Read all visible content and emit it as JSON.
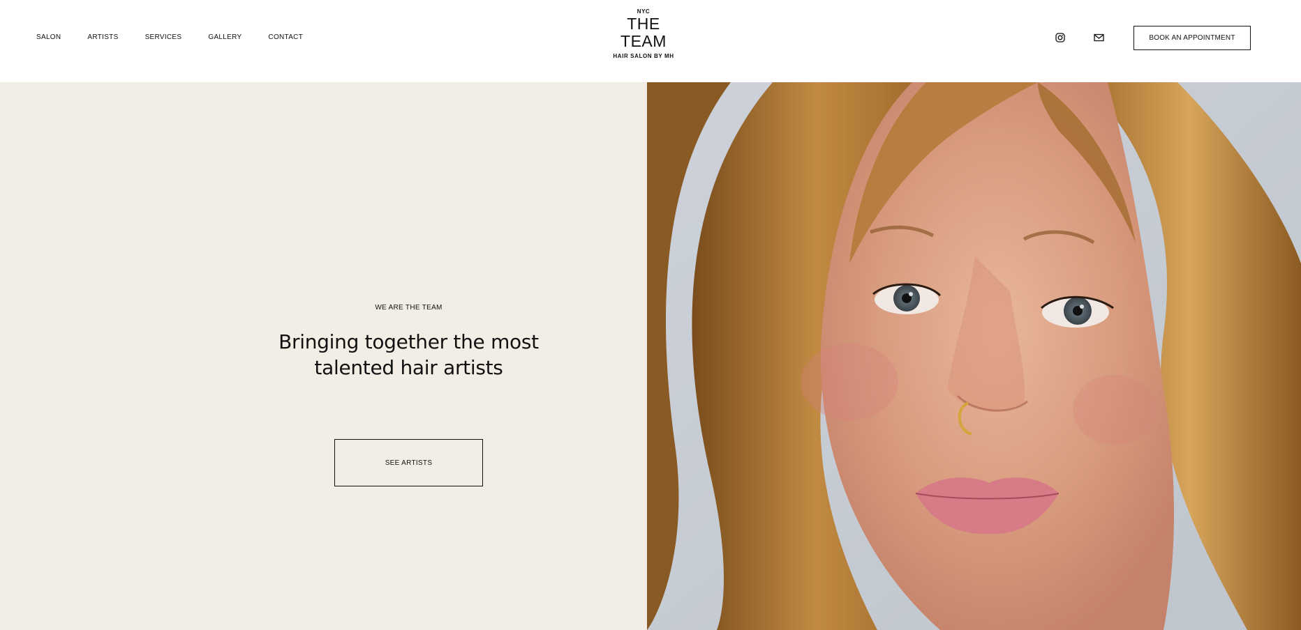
{
  "nav": {
    "items": [
      {
        "label": "SALON"
      },
      {
        "label": "ARTISTS"
      },
      {
        "label": "SERVICES"
      },
      {
        "label": "GALLERY"
      },
      {
        "label": "CONTACT"
      }
    ]
  },
  "logo": {
    "top": "NYC",
    "line1": "THE",
    "line2": "TEAM",
    "subtitle": "HAIR SALON BY MH"
  },
  "header": {
    "icons": [
      "instagram-icon",
      "mail-icon"
    ],
    "cta_label": "BOOK AN APPOINTMENT"
  },
  "hero": {
    "eyebrow": "WE ARE THE TEAM",
    "headline_line1": "Bringing together the most",
    "headline_line2": "talented hair artists",
    "button_label": "SEE ARTISTS",
    "background": "#f2ede5"
  },
  "colors": {
    "text": "#111111",
    "panel": "#f2ede5",
    "photo_backdrop": "#c9cfd8",
    "hair": "#b07a35"
  }
}
